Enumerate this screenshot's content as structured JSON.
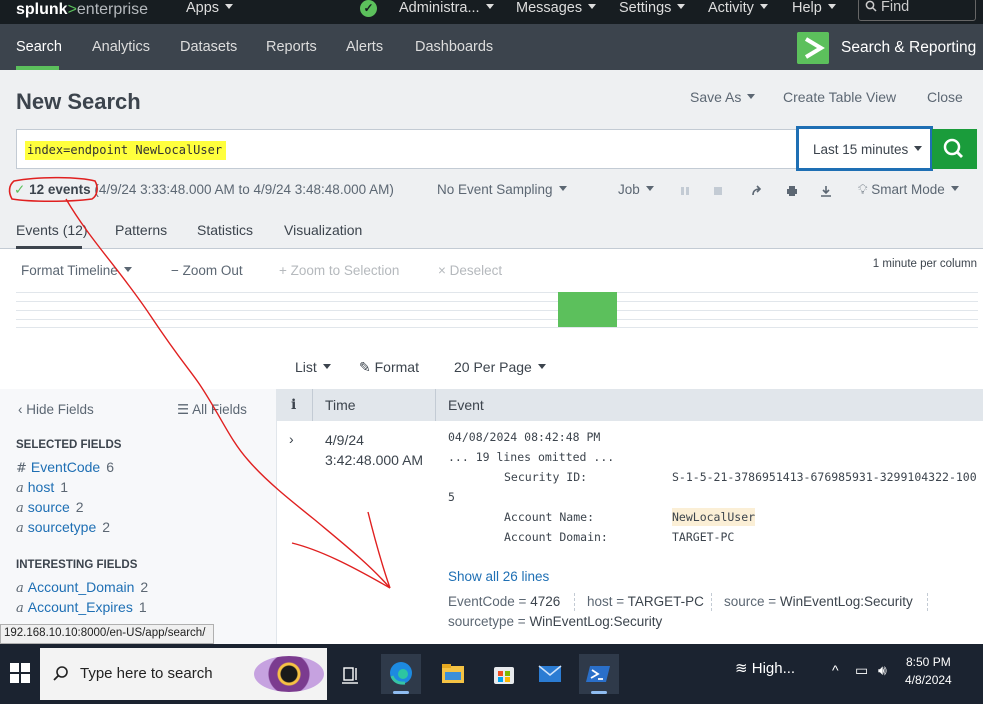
{
  "topbar": {
    "logo": {
      "splunk": "splunk",
      "gt": ">",
      "enterprise": "enterprise"
    },
    "apps": "Apps",
    "administrator": "Administra...",
    "messages": "Messages",
    "settings": "Settings",
    "activity": "Activity",
    "help": "Help",
    "find": "Find"
  },
  "appnav": {
    "items": [
      "Search",
      "Analytics",
      "Datasets",
      "Reports",
      "Alerts",
      "Dashboards"
    ],
    "app_name": "Search & Reporting"
  },
  "page": {
    "title": "New Search",
    "save_as": "Save As",
    "create_table_view": "Create Table View",
    "close": "Close"
  },
  "search": {
    "query": "index=endpoint NewLocalUser",
    "time_range": "Last 15 minutes"
  },
  "job": {
    "event_count": "12 events",
    "range": "(4/9/24 3:33:48.000 AM to 4/9/24 3:48:48.000 AM)",
    "sampling": "No Event Sampling",
    "job_label": "Job",
    "mode": "Smart Mode"
  },
  "tabs": [
    "Events (12)",
    "Patterns",
    "Statistics",
    "Visualization"
  ],
  "timeline": {
    "format": "Format Timeline",
    "zoom_out": "Zoom Out",
    "zoom_selection": "Zoom to Selection",
    "deselect": "Deselect",
    "per_column": "1 minute per column"
  },
  "results_bar": {
    "list": "List",
    "format": "Format",
    "per_page": "20 Per Page"
  },
  "sidebar": {
    "hide_fields": "Hide Fields",
    "all_fields": "All Fields",
    "selected_header": "SELECTED FIELDS",
    "selected": [
      {
        "type": "#",
        "name": "EventCode",
        "count": "6"
      },
      {
        "type": "a",
        "name": "host",
        "count": "1"
      },
      {
        "type": "a",
        "name": "source",
        "count": "2"
      },
      {
        "type": "a",
        "name": "sourcetype",
        "count": "2"
      }
    ],
    "interesting_header": "INTERESTING FIELDS",
    "interesting": [
      {
        "type": "a",
        "name": "Account_Domain",
        "count": "2"
      },
      {
        "type": "a",
        "name": "Account_Expires",
        "count": "1"
      }
    ]
  },
  "table": {
    "col_info": "i",
    "col_time": "Time",
    "col_event": "Event",
    "row": {
      "date": "4/9/24",
      "time": "3:42:48.000 AM",
      "line1": "04/08/2024 08:42:48 PM",
      "line2": "... 19 lines omitted ...",
      "sid_label": "Security ID:",
      "sid_value": "S-1-5-21-3786951413-676985931-3299104322-100",
      "sid_wrap": "5",
      "acct_label": "Account Name:",
      "acct_value": "NewLocalUser",
      "domain_label": "Account Domain:",
      "domain_value": "TARGET-PC",
      "show_all": "Show all 26 lines",
      "kv": {
        "eventcode_k": "EventCode =",
        "eventcode_v": "4726",
        "host_k": "host =",
        "host_v": "TARGET-PC",
        "source_k": "source =",
        "source_v": "WinEventLog:Security",
        "sourcetype_k": "sourcetype =",
        "sourcetype_v": "WinEventLog:Security"
      }
    }
  },
  "status_url": "192.168.10.10:8000/en-US/app/search/",
  "taskbar": {
    "search_placeholder": "Type here to search",
    "weather": "High...",
    "time": "8:50 PM",
    "date": "4/8/2024"
  },
  "colors": {
    "accent_green": "#5cc05c",
    "search_button": "#1a9c3b",
    "timepicker_border": "#1e6fb4",
    "query_highlight": "#ffff3d",
    "annotation_red": "#e02020"
  }
}
